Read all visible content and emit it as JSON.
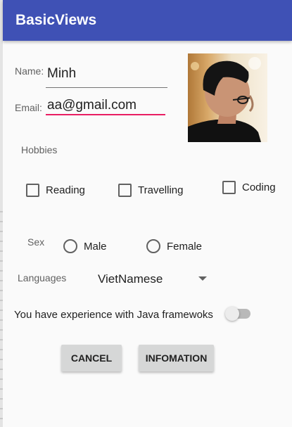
{
  "app": {
    "title": "BasicViews"
  },
  "form": {
    "name_label": "Name:",
    "name_value": "Minh",
    "email_label": "Email:",
    "email_value": "aa@gmail.com",
    "hobbies_label": "Hobbies",
    "hobbies": [
      {
        "label": "Reading",
        "checked": false
      },
      {
        "label": "Travelling",
        "checked": false
      },
      {
        "label": "Coding",
        "checked": false
      }
    ],
    "sex_label": "Sex",
    "sex_options": [
      {
        "label": "Male",
        "selected": false
      },
      {
        "label": "Female",
        "selected": false
      }
    ],
    "languages_label": "Languages",
    "language_selected": "VietNamese",
    "experience_label": "You have experience with Java framewoks",
    "experience_on": false
  },
  "buttons": {
    "cancel": "CANCEL",
    "info": "INFOMATION"
  },
  "colors": {
    "app_bar": "#3f51b5",
    "accent": "#e91e63",
    "background": "#fafafa"
  },
  "icons": {
    "profile_photo": "person-photo-icon",
    "dropdown": "arrow-drop-down-icon"
  }
}
